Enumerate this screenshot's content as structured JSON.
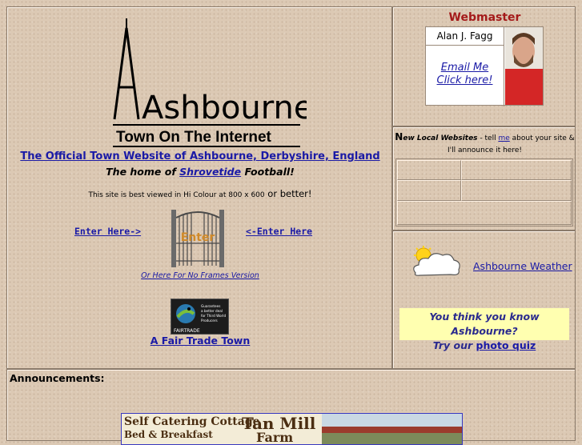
{
  "logo": {
    "line1": "Ashbourne",
    "line2": "Town On The Internet"
  },
  "intro": {
    "official_link": "The Official Town Website of Ashbourne, Derbyshire, England",
    "home_prefix": "The home of ",
    "home_link": "Shrovetide",
    "home_suffix": " Football!",
    "best_small": "This site is best viewed in Hi Colour at 800 x 600",
    "best_big": " or better!"
  },
  "enter": {
    "left_label": "Enter Here-> ",
    "right_label": "<-Enter Here ",
    "gate_text": "Enter",
    "noframes": "Or Here For No Frames Version"
  },
  "fairtrade": {
    "logo_label": "FAIRTRADE",
    "logo_text": "Guarantees a better deal for Third World Producers",
    "link": "A Fair Trade Town"
  },
  "webmaster": {
    "title": "Webmaster",
    "name": "Alan J. Fagg",
    "email_line1": "Email Me",
    "email_line2": "Click here!"
  },
  "new_local": {
    "N": "N",
    "new": "ew Local Websites",
    "text1": " - tell ",
    "me": "me",
    "text2": " about your site & I'll announce it here!"
  },
  "weather": {
    "link": "Ashbourne Weather"
  },
  "quiz": {
    "line1": "You think you know Ashbourne?",
    "line2_prefix": "Try our ",
    "link": "photo quiz"
  },
  "announcements": {
    "title": "Announcements:",
    "banner_line1": "Self Catering Cottage",
    "banner_line2": "Bed & Breakfast",
    "banner_name": "Tan Mill",
    "banner_sub": "Farm"
  },
  "colors": {
    "link": "#1a1aa6",
    "webmaster_title": "#a41a1a",
    "quiz_bg": "#ffffb0"
  }
}
